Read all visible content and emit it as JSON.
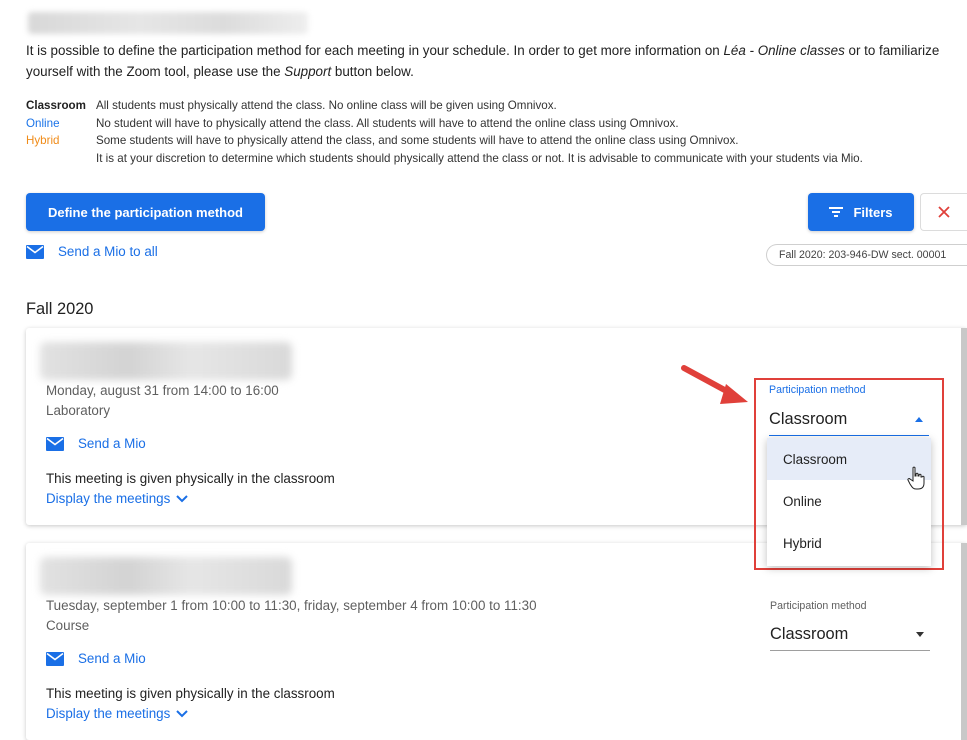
{
  "intro": {
    "text_before": "It is possible to define the participation method for each meeting in your schedule. In order to get more information on ",
    "lea_link": "Léa - Online classes",
    "text_middle": " or to familiarize yourself with the Zoom tool, please use the ",
    "support": "Support",
    "text_after": " button below."
  },
  "legend": [
    {
      "term": "Classroom",
      "desc": "All students must physically attend the class. No online class will be given using Omnivox."
    },
    {
      "term": "Online",
      "desc": "No student will have to physically attend the class. All students will have to attend the online class using Omnivox."
    },
    {
      "term": "Hybrid",
      "desc": "Some students will have to physically attend the class, and some students will have to attend the online class using Omnivox.",
      "desc2": "It is at your discretion to determine which students should physically attend the class or not. It is advisable to communicate with your students via Mio."
    }
  ],
  "actions": {
    "define_label": "Define the participation method",
    "filters_label": "Filters",
    "send_all_label": "Send a Mio to all",
    "filter_chip": "Fall 2020: 203-946-DW sect. 00001"
  },
  "section_title": "Fall 2020",
  "cards": [
    {
      "date": "Monday, august 31 from 14:00 to 16:00",
      "type": "Laboratory",
      "mio_label": "Send a Mio",
      "description": "This meeting is given physically in the classroom",
      "display_label": "Display the meetings",
      "pm_label": "Participation method",
      "pm_value": "Classroom",
      "pm_options": [
        "Classroom",
        "Online",
        "Hybrid"
      ]
    },
    {
      "date": "Tuesday, september 1 from 10:00 to 11:30, friday, september 4 from 10:00 to 11:30",
      "type": "Course",
      "mio_label": "Send a Mio",
      "description": "This meeting is given physically in the classroom",
      "display_label": "Display the meetings",
      "pm_label": "Participation method",
      "pm_value": "Classroom"
    }
  ],
  "colors": {
    "primary": "#1a6fe6",
    "hybrid": "#f08c1a",
    "highlight_box": "#e0403a",
    "arrow": "#e0403a"
  }
}
